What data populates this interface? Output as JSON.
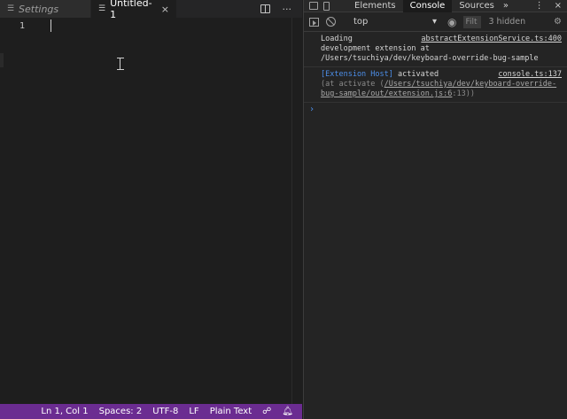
{
  "editor": {
    "tabs": [
      {
        "label": "Settings",
        "icon": "list-icon",
        "active": false
      },
      {
        "label": "Untitled-1",
        "icon": "list-icon",
        "active": true,
        "close": "×"
      }
    ],
    "actions": {
      "more": "···"
    },
    "line_number": "1"
  },
  "statusbar": {
    "position": "Ln 1, Col 1",
    "spaces": "Spaces: 2",
    "encoding": "UTF-8",
    "eol": "LF",
    "language": "Plain Text",
    "feedback_icon": "feedback-icon",
    "bell_icon": "bell-icon"
  },
  "devtools": {
    "tabs": [
      "Elements",
      "Console",
      "Sources"
    ],
    "active_tab": "Console",
    "overflow": "»",
    "kebab": "⋮",
    "close": "×",
    "toolbar": {
      "context": "top",
      "filter_placeholder": "Filt",
      "hidden": "3 hidden"
    },
    "messages": [
      {
        "source": "abstractExtensionService.ts:400",
        "lines": [
          "Loading",
          "development extension at",
          "/Users/tsuchiya/dev/keyboard-override-bug-sample"
        ]
      },
      {
        "tag": "[Extension Host]",
        "text": "activated",
        "source": "console.ts:137",
        "sub_prefix": "(at activate (",
        "sub_link": "/Users/tsuchiya/dev/keyboard-override-bug-sample/out/extension.js:6",
        "sub_suffix": ":13))"
      }
    ],
    "prompt": "›"
  },
  "colors": {
    "statusbar": "#6b2c91",
    "editor_bg": "#1e1e1e",
    "devtools_bg": "#242424",
    "link_blue": "#4c8ee8"
  }
}
